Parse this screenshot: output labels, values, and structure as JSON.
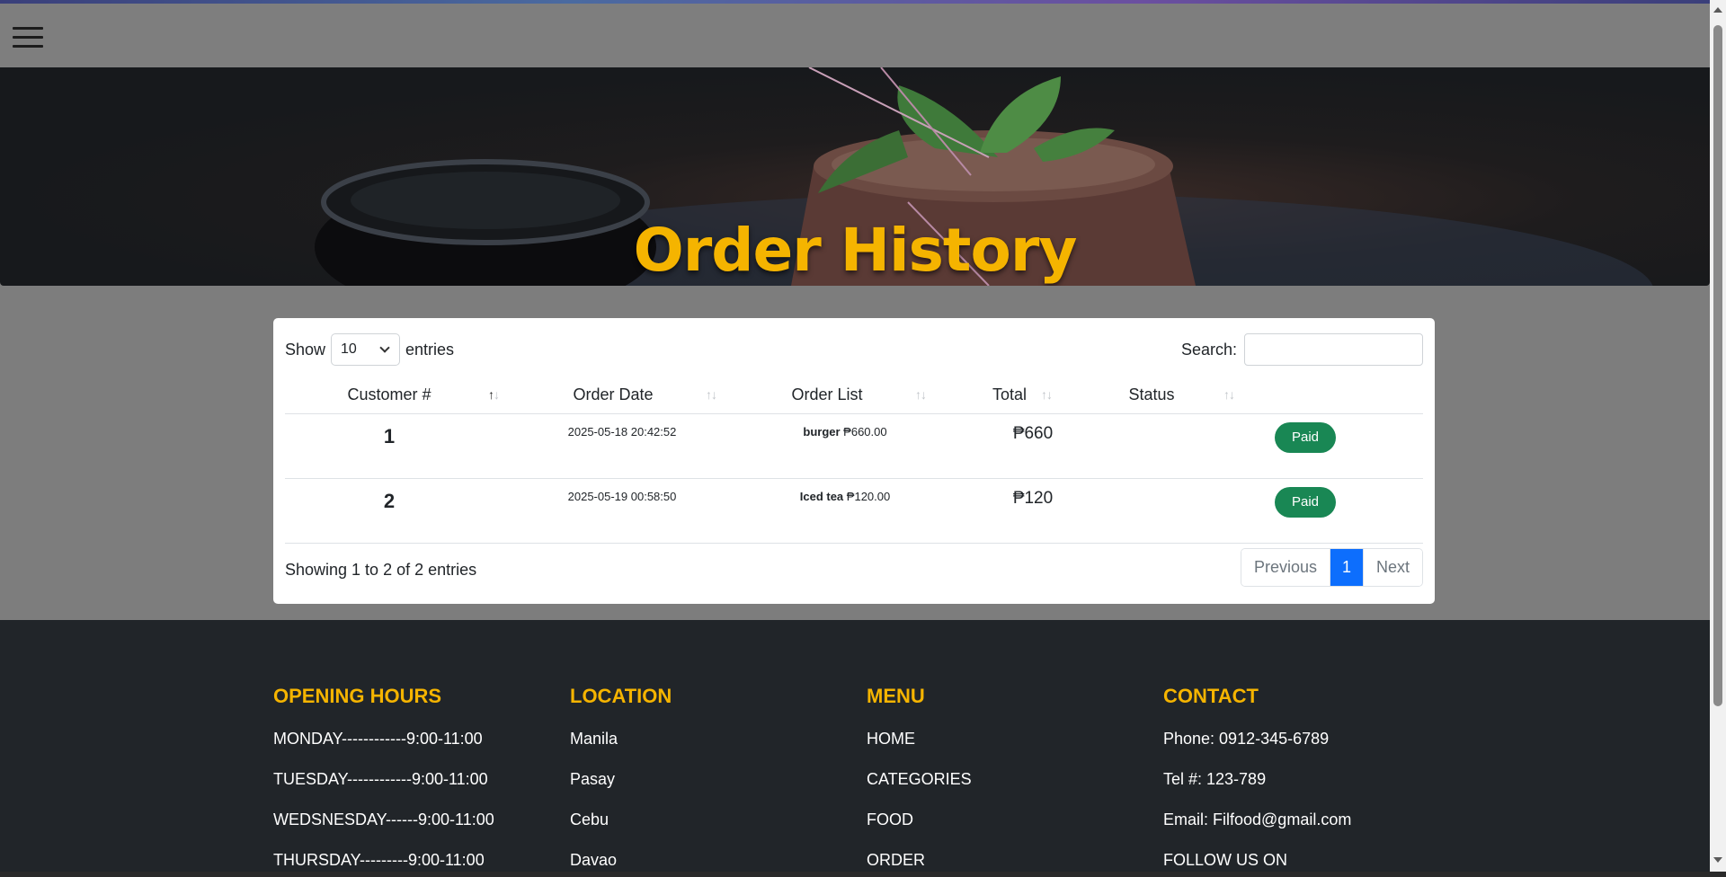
{
  "hero": {
    "title": "Order History"
  },
  "table_controls": {
    "show_label": "Show",
    "entries_value": "10",
    "entries_label": "entries",
    "search_label": "Search:",
    "search_value": ""
  },
  "table": {
    "columns": [
      "Customer #",
      "Order Date",
      "Order List",
      "Total",
      "Status"
    ],
    "rows": [
      {
        "customer": "1",
        "date": "2025-05-18 20:42:52",
        "item": "burger",
        "item_price": "₱660.00",
        "total": "₱660",
        "status": "Paid"
      },
      {
        "customer": "2",
        "date": "2025-05-19 00:58:50",
        "item": "Iced tea",
        "item_price": "₱120.00",
        "total": "₱120",
        "status": "Paid"
      }
    ],
    "info": "Showing 1 to 2 of 2 entries",
    "pagination": {
      "previous": "Previous",
      "current": "1",
      "next": "Next"
    }
  },
  "footer": {
    "hours": {
      "title": "OPENING HOURS",
      "items": [
        "MONDAY------------9:00-11:00",
        "TUESDAY------------9:00-11:00",
        "WEDSNESDAY------9:00-11:00",
        "THURSDAY---------9:00-11:00"
      ]
    },
    "location": {
      "title": "LOCATION",
      "items": [
        "Manila",
        "Pasay",
        "Cebu",
        "Davao"
      ]
    },
    "menu": {
      "title": "MENU",
      "items": [
        "HOME",
        "CATEGORIES",
        "FOOD",
        "ORDER"
      ]
    },
    "contact": {
      "title": "CONTACT",
      "items": [
        "Phone: 0912-345-6789",
        "Tel #: 123-789",
        "Email: Filfood@gmail.com",
        "FOLLOW US ON"
      ]
    }
  },
  "colors": {
    "accent": "#f5b400",
    "paid": "#198754",
    "pager_active": "#0d6efd",
    "footer_bg": "#212529"
  },
  "icons": {
    "menu": "hamburger-icon",
    "sort": "sort-arrows-icon",
    "select": "chevron-down-icon"
  }
}
